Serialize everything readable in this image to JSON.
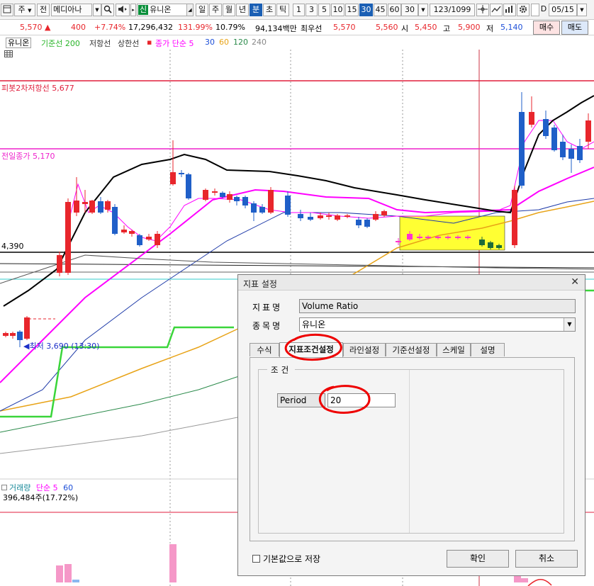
{
  "toolbar": {
    "period_code": "주",
    "prev_label": "전",
    "stock_code_name": "메디아나",
    "sin_label": "신",
    "stock_name": "유니온",
    "periods": [
      "일",
      "주",
      "월",
      "년",
      "분",
      "초",
      "틱"
    ],
    "active_period": "분",
    "intervals": [
      "1",
      "3",
      "5",
      "10",
      "15",
      "30",
      "45",
      "60"
    ],
    "active_interval": "30",
    "interval_value": "30",
    "page_count": "123/1099",
    "checkbox_label": "D",
    "date": "05/15"
  },
  "price_info": {
    "price": "5,570",
    "change_arrow": "▲",
    "change": "400",
    "change_pct": "+7.74%",
    "volume": "17,296,432",
    "volume_ratio": "131.99%",
    "turnover": "10.79%",
    "amount": "94,134백만",
    "best_ask_label": "최우선",
    "best_ask": "5,570",
    "best_bid": "5,560",
    "open_label": "시",
    "open": "5,450",
    "high_label": "고",
    "high": "5,900",
    "low_label": "저",
    "low": "5,140",
    "buy_label": "매수",
    "sell_label": "매도"
  },
  "legend": {
    "stock": "유니온",
    "base_line": "기준선 200",
    "resistance": "저항선",
    "upper_line": "상한선",
    "ma_label": "종가 단순 5",
    "ma_periods": [
      "30",
      "60",
      "120",
      "240"
    ]
  },
  "chart_labels": {
    "pivot": "피봇2차저항선 5,677",
    "prev_close": "전일종가 5,170",
    "level_4390": "4,390",
    "low_marker": "최저 3,690 (13:30)",
    "volume_title": "거래량",
    "volume_ma": "단순 5",
    "volume_ma_period": "60",
    "volume_value": "396,484주(17.72%)"
  },
  "colors": {
    "up": "#e8262c",
    "down": "#1f5fc8",
    "pivot_line": "#e01e3c",
    "prev_close_line": "#ee22cc",
    "ma5": "#ff00ff",
    "ma60": "#e8a317",
    "base_line": "#3ad53a",
    "highlight": "#ffff33"
  },
  "dialog": {
    "title": "지표 설정",
    "indicator_label": "지표명",
    "indicator_value": "Volume Ratio",
    "stock_label": "종목명",
    "stock_value": "유니온",
    "tabs": [
      "수식",
      "지표조건설정",
      "라인설정",
      "기준선설정",
      "스케일",
      "설명"
    ],
    "active_tab": "지표조건설정",
    "group_title": "조건",
    "param_label": "Period",
    "param_value": "20",
    "save_default_label": "기본값으로 저장",
    "ok_label": "확인",
    "cancel_label": "취소"
  }
}
